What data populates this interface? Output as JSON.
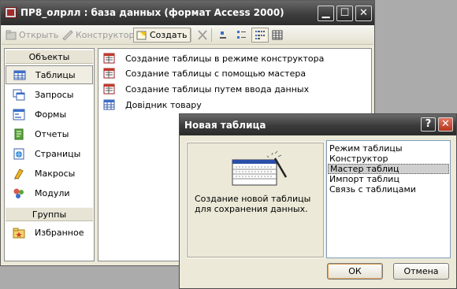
{
  "window": {
    "title": "ПР8_олрлл : база данных (формат Access 2000)",
    "minimize": "▁",
    "maximize": "☐",
    "close": "✕"
  },
  "toolbar": {
    "open_label": "Открыть",
    "designer_label": "Конструктор",
    "create_label": "Создать"
  },
  "sidebar": {
    "objects_header": "Объекты",
    "items": [
      {
        "label": "Таблицы",
        "icon": "table-icon"
      },
      {
        "label": "Запросы",
        "icon": "query-icon"
      },
      {
        "label": "Формы",
        "icon": "form-icon"
      },
      {
        "label": "Отчеты",
        "icon": "report-icon"
      },
      {
        "label": "Страницы",
        "icon": "page-icon"
      },
      {
        "label": "Макросы",
        "icon": "macro-icon"
      },
      {
        "label": "Модули",
        "icon": "module-icon"
      }
    ],
    "groups_header": "Группы",
    "favorites_label": "Избранное"
  },
  "object_list": [
    {
      "label": "Создание таблицы в режиме конструктора",
      "icon": "wizard-shortcut-icon"
    },
    {
      "label": "Создание таблицы с помощью мастера",
      "icon": "wizard-shortcut-icon"
    },
    {
      "label": "Создание таблицы путем ввода данных",
      "icon": "wizard-shortcut-icon"
    },
    {
      "label": "Довідник товару",
      "icon": "table-icon"
    }
  ],
  "dialog": {
    "title": "Новая таблица",
    "help": "?",
    "close": "✕",
    "description": "Создание новой таблицы для сохранения данных.",
    "options": [
      "Режим таблицы",
      "Конструктор",
      "Мастер таблиц",
      "Импорт таблиц",
      "Связь с таблицами"
    ],
    "selected_option": "Мастер таблиц",
    "ok_label": "ОК",
    "cancel_label": "Отмена"
  },
  "colors": {
    "titlebar": "#3e3e3e",
    "window_bg": "#ece9d8",
    "desktop": "#ababab",
    "close_button": "#c7442a"
  }
}
